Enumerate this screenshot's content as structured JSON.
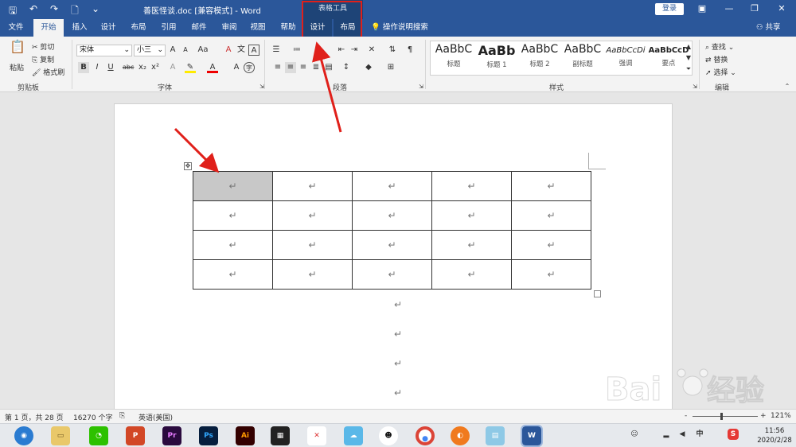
{
  "titlebar": {
    "doc_title": "善医怪谈.doc [兼容模式] - Word",
    "context_header": "表格工具",
    "login": "登录"
  },
  "tabs": [
    "文件",
    "开始",
    "插入",
    "设计",
    "布局",
    "引用",
    "邮件",
    "审阅",
    "视图",
    "帮助"
  ],
  "context_tabs": [
    "设计",
    "布局"
  ],
  "tell_me": "操作说明搜索",
  "share": "共享",
  "ribbon": {
    "clipboard": {
      "paste": "粘贴",
      "cut": "剪切",
      "copy": "复制",
      "format_painter": "格式刷",
      "label": "剪贴板"
    },
    "font": {
      "name": "宋体",
      "size": "小三",
      "label": "字体"
    },
    "paragraph": {
      "label": "段落"
    },
    "styles": {
      "label": "样式",
      "items": [
        {
          "sample": "AaBbC",
          "name": "标题"
        },
        {
          "sample": "AaBb",
          "name": "标题 1"
        },
        {
          "sample": "AaBbC",
          "name": "标题 2"
        },
        {
          "sample": "AaBbC",
          "name": "副标题"
        },
        {
          "sample": "AaBbCcDi",
          "name": "强调"
        },
        {
          "sample": "AaBbCcD",
          "name": "要点"
        }
      ]
    },
    "editing": {
      "find": "查找",
      "replace": "替换",
      "select": "选择",
      "label": "编辑"
    }
  },
  "table": {
    "rows": 4,
    "cols": 5,
    "cell_mark": "↵"
  },
  "para_mark": "↵",
  "statusbar": {
    "page": "第 1 页，共 28 页",
    "words": "16270 个字",
    "language": "英语(美国)",
    "zoom": "121%",
    "zoom_minus": "-",
    "zoom_plus": "+"
  },
  "clock": {
    "time": "11:56",
    "date": "2020/2/28"
  },
  "taskbar_apps": [
    "Pr",
    "Ps",
    "Ai"
  ],
  "colors": {
    "word_blue": "#2b579a",
    "highlight_red": "#e0201a"
  }
}
